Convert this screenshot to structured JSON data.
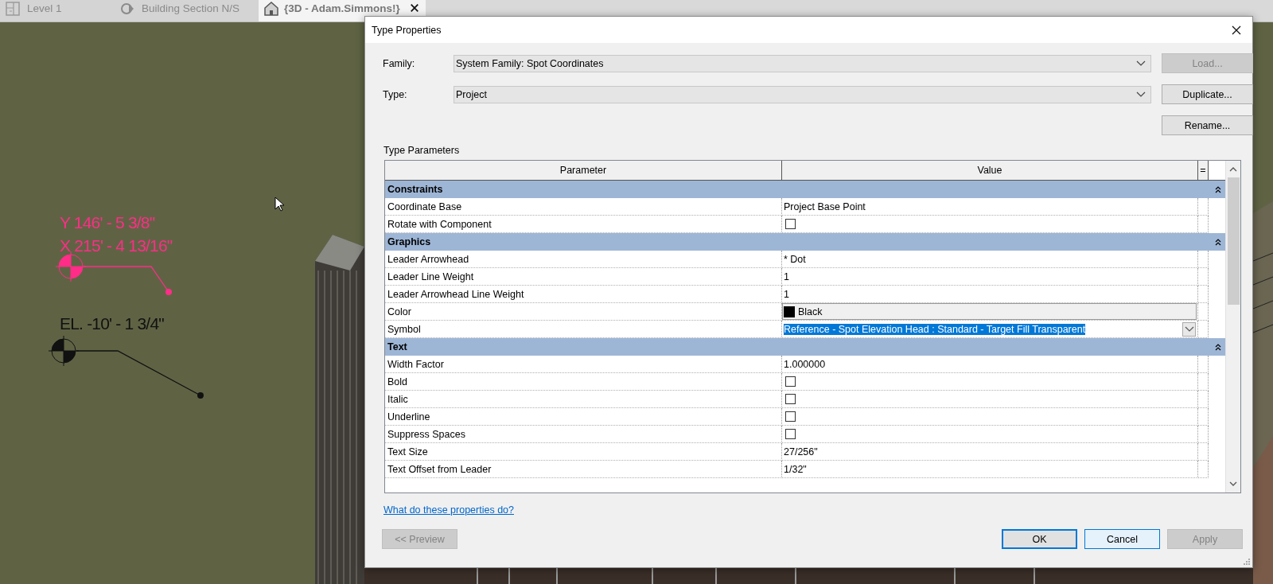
{
  "view_tabs": [
    {
      "label": "Level 1",
      "kind": "plan",
      "selected": false
    },
    {
      "label": "Building Section N/S",
      "kind": "section",
      "selected": false
    },
    {
      "label": "{3D - Adam.Simmons!}",
      "kind": "model",
      "selected": true
    }
  ],
  "annotations": [
    {
      "kind": "spot_coordinate",
      "lines": [
        "Y 146' - 5 3/8\"",
        "X 215' - 4 13/16\""
      ],
      "selected": true
    },
    {
      "kind": "spot_elevation",
      "lines": [
        "EL. -10' - 1 3/4\""
      ],
      "selected": false
    }
  ],
  "dialog": {
    "title": "Type Properties",
    "family": {
      "label": "Family:",
      "value": "System Family: Spot Coordinates"
    },
    "type": {
      "label": "Type:",
      "value": "Project"
    },
    "side_buttons": [
      {
        "label": "Load...",
        "disabled": true
      },
      {
        "label": "Duplicate...",
        "disabled": false
      },
      {
        "label": "Rename...",
        "disabled": false
      }
    ],
    "section_label": "Type Parameters",
    "columns": [
      "Parameter",
      "Value",
      "="
    ],
    "groups": [
      {
        "name": "Constraints",
        "expanded": true,
        "rows": [
          {
            "name": "Coordinate Base",
            "kind": "text",
            "value": "Project Base Point"
          },
          {
            "name": "Rotate with Component",
            "kind": "checkbox",
            "checked": false
          }
        ]
      },
      {
        "name": "Graphics",
        "expanded": true,
        "rows": [
          {
            "name": "Leader Arrowhead",
            "kind": "text",
            "value": "* Dot"
          },
          {
            "name": "Leader Line Weight",
            "kind": "text",
            "value": "1"
          },
          {
            "name": "Leader Arrowhead Line Weight",
            "kind": "text",
            "value": "1"
          },
          {
            "name": "Color",
            "kind": "color",
            "value": "Black",
            "color": "#000000"
          },
          {
            "name": "Symbol",
            "kind": "dropdown",
            "value": "Reference - Spot Elevation Head : Standard - Target Fill Transparent",
            "selected": true
          }
        ]
      },
      {
        "name": "Text",
        "expanded": true,
        "rows": [
          {
            "name": "Width Factor",
            "kind": "text",
            "value": "1.000000"
          },
          {
            "name": "Bold",
            "kind": "checkbox",
            "checked": false
          },
          {
            "name": "Italic",
            "kind": "checkbox",
            "checked": false
          },
          {
            "name": "Underline",
            "kind": "checkbox",
            "checked": false
          },
          {
            "name": "Suppress Spaces",
            "kind": "checkbox",
            "checked": false
          },
          {
            "name": "Text Size",
            "kind": "text",
            "value": "27/256\""
          },
          {
            "name": "Text Offset from Leader",
            "kind": "text",
            "value": "1/32\""
          }
        ]
      }
    ],
    "help_link": "What do these properties do?",
    "buttons": [
      {
        "label": "<< Preview",
        "disabled": true,
        "default": false,
        "focused": false
      },
      {
        "label": "OK",
        "disabled": false,
        "default": true,
        "focused": false
      },
      {
        "label": "Cancel",
        "disabled": false,
        "default": false,
        "focused": true
      },
      {
        "label": "Apply",
        "disabled": true,
        "default": false,
        "focused": false
      }
    ]
  }
}
